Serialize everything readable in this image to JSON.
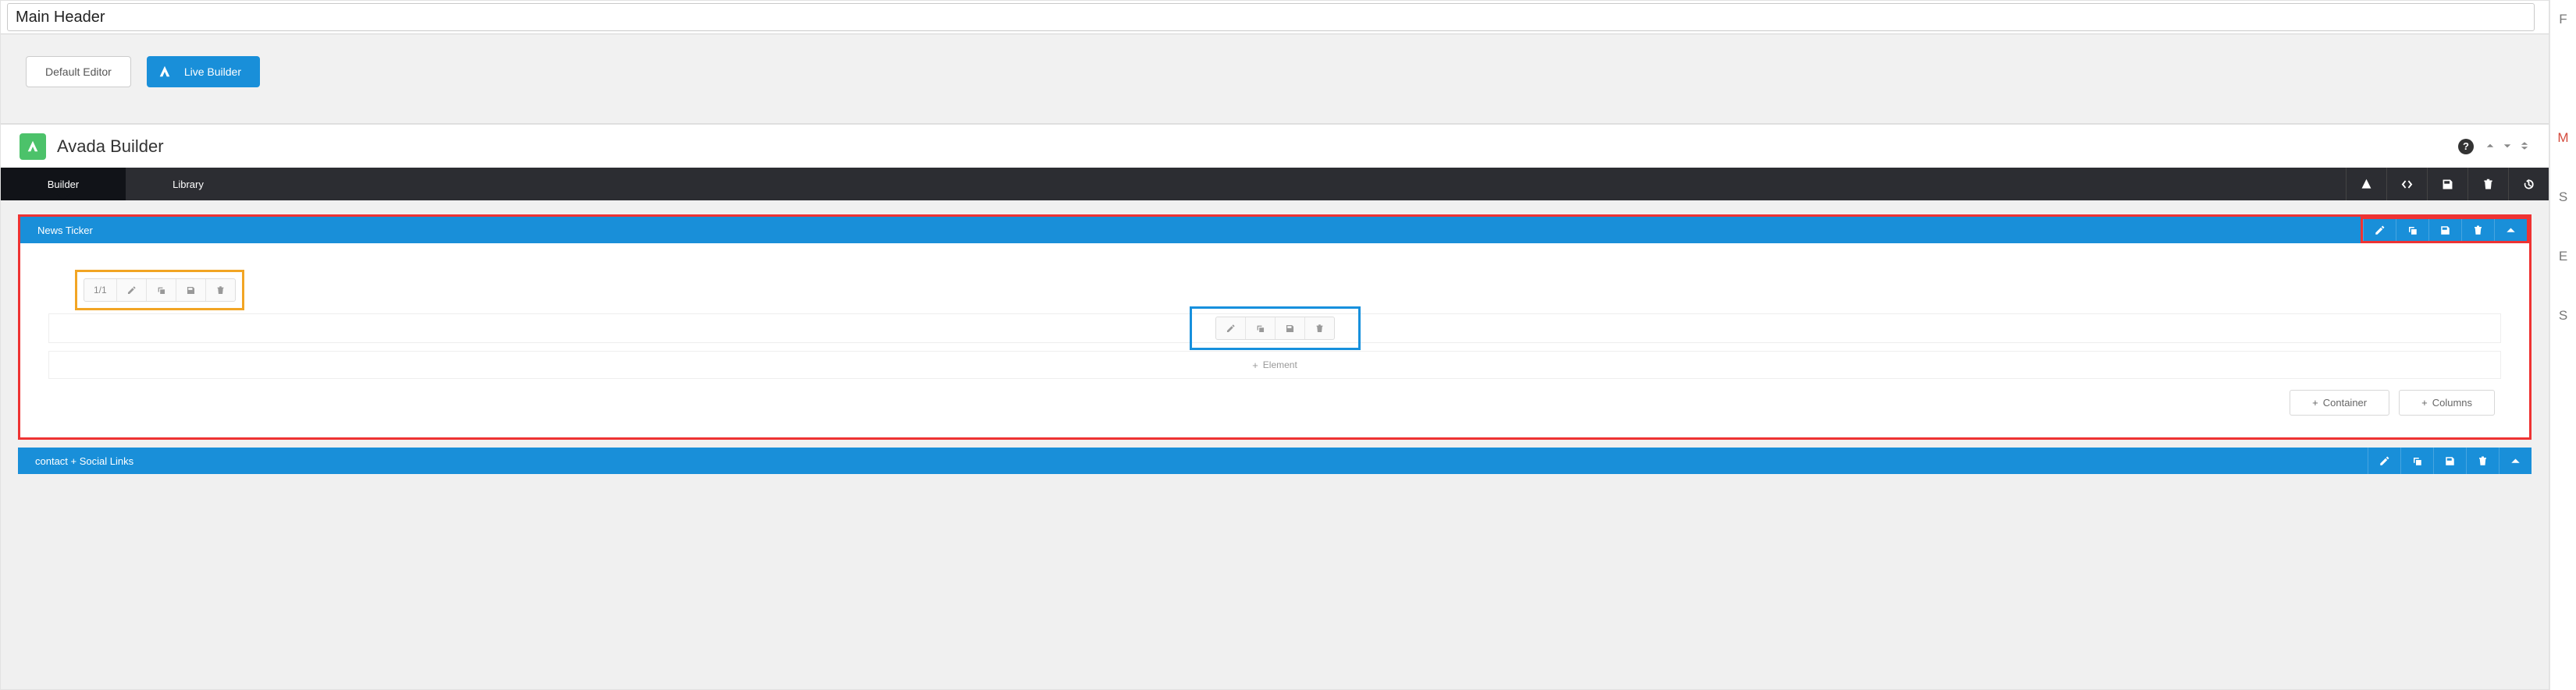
{
  "title_input": "Main Header",
  "mode_bar": {
    "default_editor": "Default Editor",
    "live_builder": "Live Builder"
  },
  "avada_header": {
    "title": "Avada Builder",
    "help_glyph": "?"
  },
  "dark_tabs": {
    "builder": "Builder",
    "library": "Library"
  },
  "containers": [
    {
      "label": "News Ticker",
      "column": {
        "ratio": "1/1"
      },
      "add_element_label": "Element"
    },
    {
      "label": "contact + Social Links"
    }
  ],
  "footer": {
    "container": "Container",
    "columns": "Columns"
  },
  "side_strip_letters": [
    "F",
    " ",
    " ",
    " ",
    "M",
    " ",
    "S",
    " ",
    "E",
    " ",
    "S",
    " "
  ]
}
